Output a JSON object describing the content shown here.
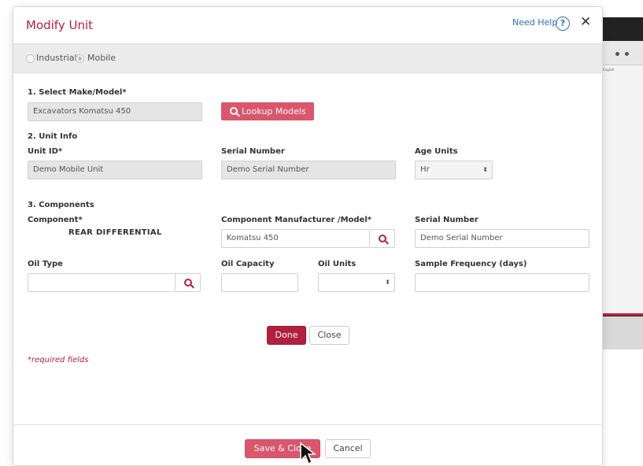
{
  "modal": {
    "title": "Modify Unit",
    "need_help": "Need Help",
    "help_glyph": "?",
    "close_glyph": "✕"
  },
  "unit_type": {
    "options": [
      "Industrial",
      "Mobile"
    ],
    "selected": "Mobile"
  },
  "section1": {
    "heading": "1. Select Make/Model*",
    "make_model_value": "Excavators Komatsu 450",
    "lookup_button": "Lookup Models"
  },
  "section2": {
    "heading": "2. Unit Info",
    "unit_id_label": "Unit ID*",
    "unit_id_value": "Demo Mobile Unit",
    "serial_label": "Serial Number",
    "serial_value": "Demo Serial Number",
    "age_units_label": "Age Units",
    "age_units_value": "Hr"
  },
  "section3": {
    "heading": "3. Components",
    "component_label": "Component*",
    "component_value": "REAR DIFFERENTIAL",
    "manufacturer_label": "Component Manufacturer /Model*",
    "manufacturer_value": "Komatsu 450",
    "serial_label": "Serial Number",
    "serial_value": "Demo Serial Number",
    "oil_type_label": "Oil Type",
    "oil_type_value": "",
    "oil_capacity_label": "Oil Capacity",
    "oil_capacity_value": "",
    "oil_units_label": "Oil Units",
    "oil_units_value": "",
    "sample_frequency_label": "Sample Frequency (days)",
    "sample_frequency_value": ""
  },
  "component_actions": {
    "done": "Done",
    "close": "Close"
  },
  "required_note": "*required fields",
  "footer": {
    "save_close": "Save & Close",
    "cancel": "Cancel"
  },
  "background_app": {
    "language": "English"
  },
  "colors": {
    "brand": "#b3203f",
    "brand_light": "#d9566c",
    "link": "#2e6fb7"
  },
  "icons": [
    "search-icon",
    "help-icon",
    "close-icon",
    "select-caret-icon",
    "cursor-arrow-icon"
  ]
}
